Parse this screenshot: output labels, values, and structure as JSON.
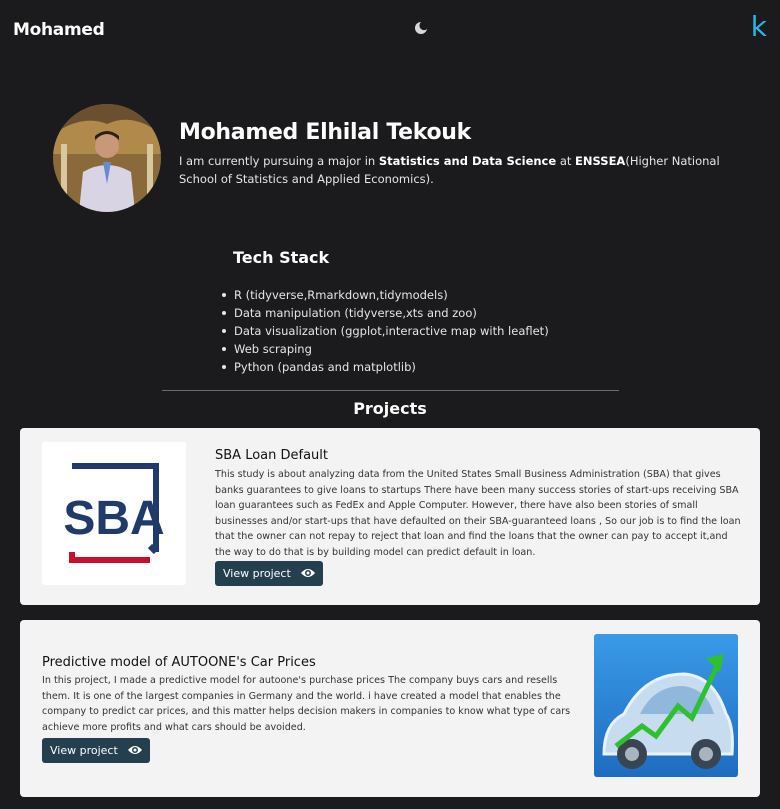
{
  "nav": {
    "brand": "Mohamed",
    "theme_icon": "moon-icon",
    "logo_letter": "k"
  },
  "profile": {
    "name": "Mohamed Elhilal Tekouk",
    "bio_prefix": "I am currently pursuing a major in ",
    "bio_major": "Statistics and Data Science",
    "bio_mid": " at ",
    "bio_school": "ENSSEA",
    "bio_suffix": "(Higher National School of Statistics and Applied Economics)."
  },
  "tech_stack": {
    "title": "Tech Stack",
    "items": [
      "R (tidyverse,Rmarkdown,tidymodels)",
      "Data manipulation (tidyverse,xts and zoo)",
      "Data visualization (ggplot,interactive map with leaflet)",
      "Web scraping",
      "Python (pandas and matplotlib)"
    ]
  },
  "projects": {
    "title": "Projects",
    "items": [
      {
        "title": "SBA Loan Default",
        "description": "This study is about analyzing data from the United States Small Business Administration (SBA) that gives banks guarantees to give loans to startups There have been many success stories of start-ups receiving SBA loan guarantees such as FedEx and Apple Computer. However, there have also been stories of small businesses and/or start-ups that have defaulted on their SBA-guaranteed loans , So our job is to find the loan that the owner can not repay to reject that loan and find the loans that the owner can pay to accept it,and the way to do that is by building model can predict default in loan.",
        "button_label": "View project",
        "logo_text": "SBA"
      },
      {
        "title": "Predictive model of AUTOONE's Car Prices",
        "description": "In this project, I made a predictive model for autoone's purchase prices The company buys cars and resells them. It is one of the largest companies in Germany and the world. i have created a model that enables the company to predict car prices, and this matter helps decision makers in companies to know what type of cars achieve more profits and what cars should be avoided.",
        "button_label": "View project"
      }
    ]
  },
  "colors": {
    "background": "#1b1b1d",
    "card": "#f3f3f3",
    "button": "#24404f",
    "logo": "#29b6e6",
    "sba_navy": "#1f3a6b",
    "sba_red": "#c8102e"
  }
}
